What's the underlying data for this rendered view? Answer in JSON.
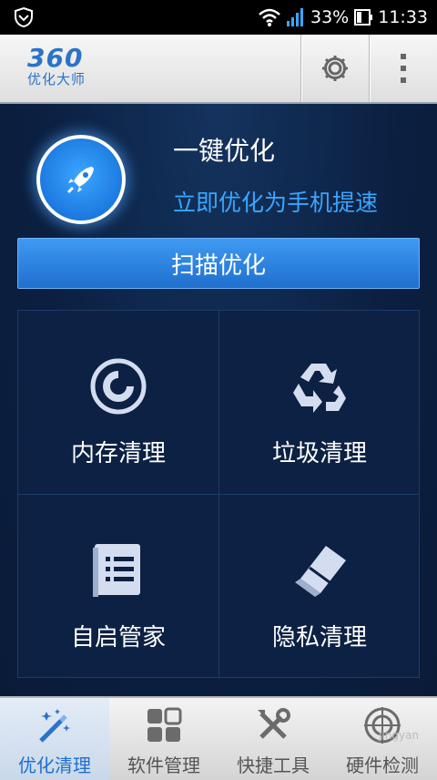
{
  "status_bar": {
    "battery": "33%",
    "time": "11:33"
  },
  "app_bar": {
    "logo_number": "360",
    "logo_text": "优化大师",
    "settings_icon": "gear-icon",
    "menu_icon": "overflow-menu-icon"
  },
  "hero": {
    "title": "一键优化",
    "subtitle": "立即优化为手机提速",
    "scan_button": "扫描优化"
  },
  "tools": [
    {
      "label": "内存清理",
      "icon": "memory-icon"
    },
    {
      "label": "垃圾清理",
      "icon": "recycle-icon"
    },
    {
      "label": "自启管家",
      "icon": "list-icon"
    },
    {
      "label": "隐私清理",
      "icon": "eraser-icon"
    }
  ],
  "bottom_tabs": [
    {
      "label": "优化清理",
      "icon": "magic-wand-icon",
      "active": true
    },
    {
      "label": "软件管理",
      "icon": "grid-icon",
      "active": false
    },
    {
      "label": "快捷工具",
      "icon": "tools-icon",
      "active": false
    },
    {
      "label": "硬件检测",
      "icon": "crosshair-icon",
      "active": false
    }
  ],
  "watermark": "jingyan"
}
